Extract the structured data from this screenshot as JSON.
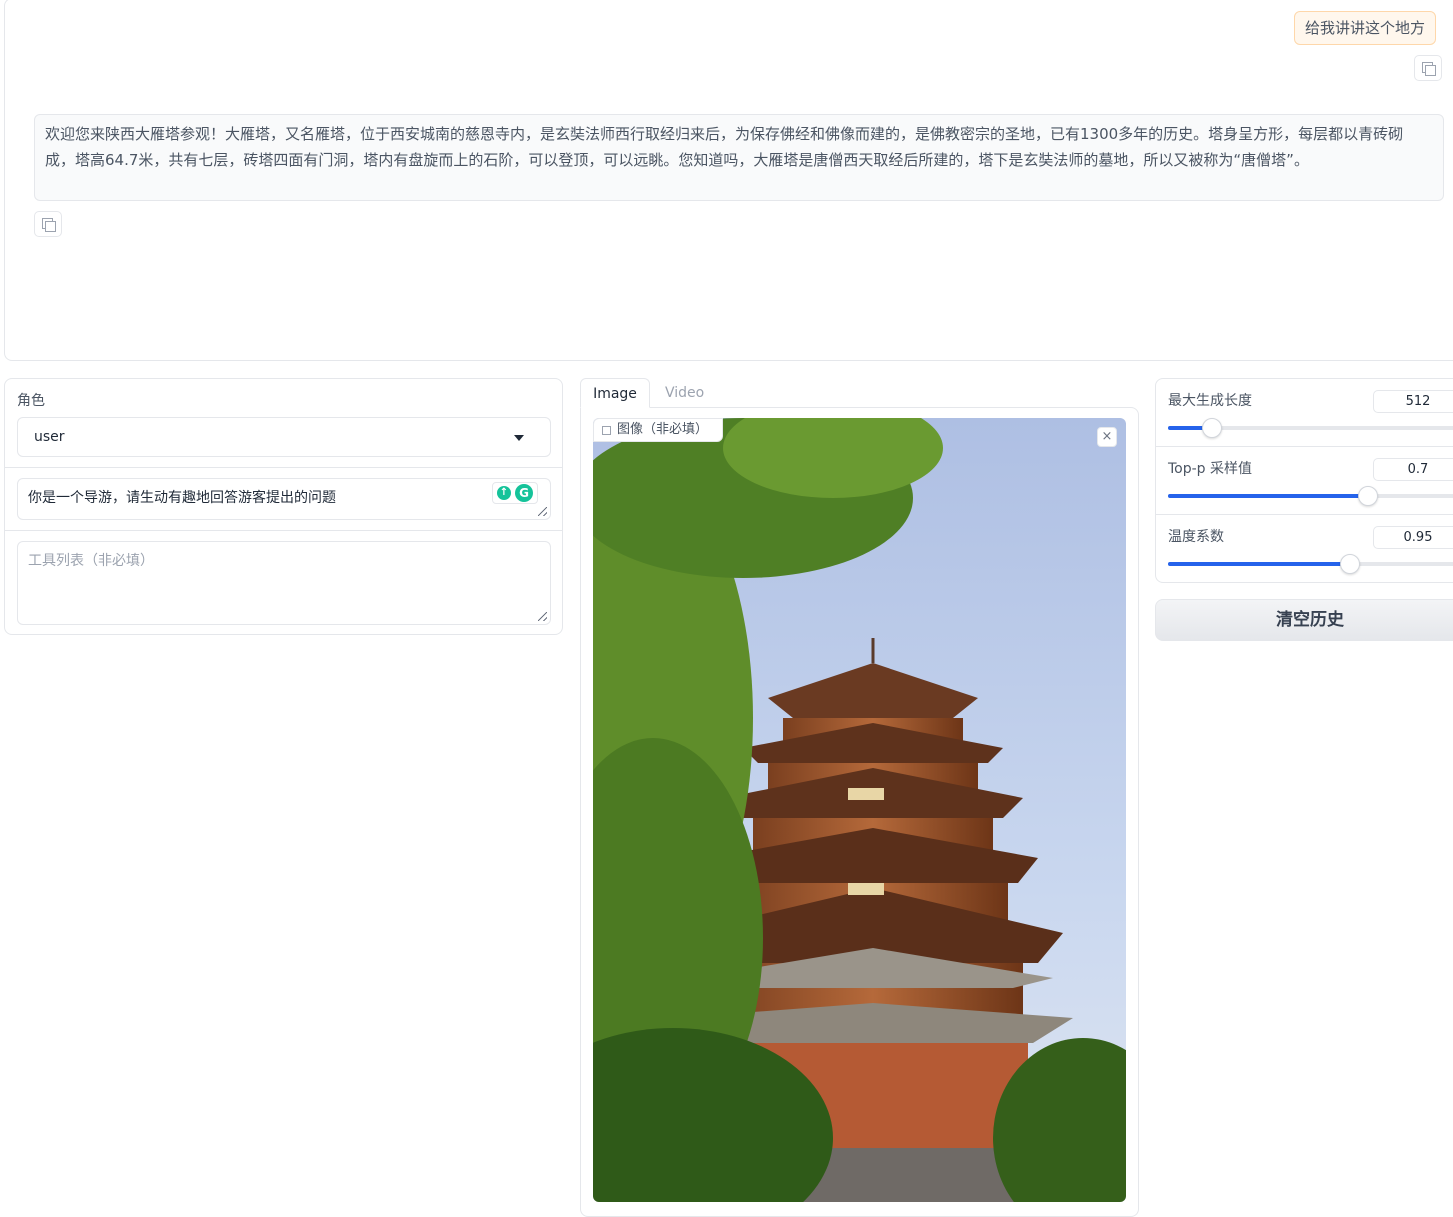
{
  "chat": {
    "user_message": "给我讲讲这个地方",
    "bot_message": "欢迎您来陕西大雁塔参观！大雁塔，又名雁塔，位于西安城南的慈恩寺内，是玄奘法师西行取经归来后，为保存佛经和佛像而建的，是佛教密宗的圣地，已有1300多年的历史。塔身呈方形，每层都以青砖砌成，塔高64.7米，共有七层，砖塔四面有门洞，塔内有盘旋而上的石阶，可以登顶，可以远眺。您知道吗，大雁塔是唐僧西天取经后所建的，塔下是玄奘法师的墓地，所以又被称为“唐僧塔”。"
  },
  "left": {
    "role_label": "角色",
    "role_value": "user",
    "system_prompt": "你是一个导游，请生动有趣地回答游客提出的问题",
    "tools_placeholder": "工具列表（非必填）"
  },
  "media": {
    "tabs": [
      "Image",
      "Video"
    ],
    "image_label": "图像（非必填）",
    "close": "×"
  },
  "params": {
    "max_len": {
      "label": "最大生成长度",
      "value": "512",
      "fraction": 0.145
    },
    "top_p": {
      "label": "Top-p 采样值",
      "value": "0.7",
      "fraction": 0.667
    },
    "temperature": {
      "label": "温度系数",
      "value": "0.95",
      "fraction": 0.608
    }
  },
  "clear_button": "清空历史"
}
